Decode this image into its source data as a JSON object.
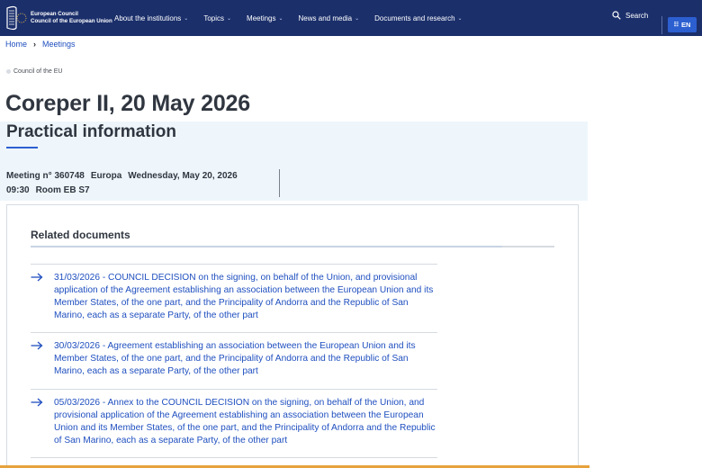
{
  "header": {
    "logo_line1": "European Council",
    "logo_line2": "Council of the European Union",
    "nav": [
      {
        "label": "About the institutions"
      },
      {
        "label": "Topics"
      },
      {
        "label": "Meetings"
      },
      {
        "label": "News and media"
      },
      {
        "label": "Documents and research"
      }
    ],
    "search_label": "Search",
    "language": "EN",
    "colors": {
      "bar": "#1b2f6b",
      "accent": "#2c5fd0"
    }
  },
  "breadcrumb": [
    "Home",
    "Meetings"
  ],
  "tag": "Council of the EU",
  "title": "Coreper II, 20 May 2026",
  "practical": {
    "heading": "Practical information",
    "meeting_no": "Meeting n° 360748",
    "location": "Europa",
    "date": "Wednesday, May 20, 2026",
    "time": "09:30",
    "room": "Room EB S7"
  },
  "related": {
    "heading": "Related documents",
    "documents": [
      {
        "text": "31/03/2026 - COUNCIL DECISION on the signing, on behalf of the Union, and provisional application of the Agreement establishing an association between the European Union and its Member States, of the one part, and the Principality of Andorra and the Republic of San Marino, each as a separate Party, of the other part"
      },
      {
        "text": "30/03/2026 - Agreement establishing an association between the European Union and its Member States, of the one part, and the Principality of Andorra and the Republic of San Marino, each as a separate Party, of the other part"
      },
      {
        "text": "05/03/2026 - Annex to the COUNCIL DECISION on the signing, on behalf of the Union, and provisional application of the Agreement establishing an association between the European Union and its Member States, of the one part, and the Principality of Andorra and the Republic of San Marino, each as a separate Party, of the other part"
      }
    ]
  }
}
